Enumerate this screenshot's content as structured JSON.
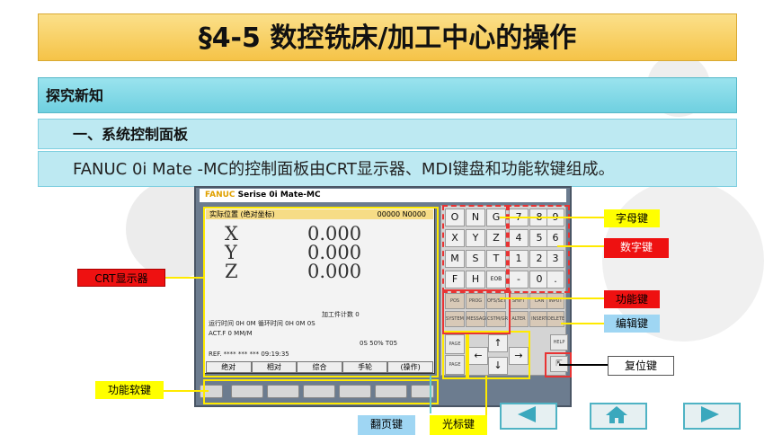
{
  "slide": {
    "title": "§4-5  数控铣床/加工中心的操作",
    "section": "探究新知",
    "subsection": "一、系统控制面板",
    "description": "FANUC 0i Mate -MC的控制面板由CRT显示器、MDI键盘和功能软键组成。"
  },
  "panel": {
    "brand": "FANUC",
    "model": "Serise 0i Mate-MC",
    "screen_header_left": "实际位置  (绝对坐标)",
    "screen_header_right": "00000  N0000",
    "axes": [
      {
        "label": "X",
        "value": "0.000"
      },
      {
        "label": "Y",
        "value": "0.000"
      },
      {
        "label": "Z",
        "value": "0.000"
      }
    ],
    "status_line1": "加工件计数                0",
    "status_line2": "运行时间         0H 0M   循环时间        0H  0M   0S",
    "status_line3": "ACT.F           0   MM/M",
    "status_line4": "0S   50%   T05",
    "status_line5": "REF.   **** *** ***      09:19:35",
    "softkeys": [
      "绝对",
      "相对",
      "综合",
      "手轮",
      "(操作)"
    ],
    "keys_letters": [
      "O",
      "N",
      "G",
      "X",
      "Y",
      "Z",
      "M",
      "S",
      "T",
      "F",
      "H",
      "EOB"
    ],
    "keys_numbers": [
      "7",
      "8",
      "9",
      "4",
      "5",
      "6",
      "1",
      "2",
      "3",
      "-",
      "0",
      "."
    ],
    "func_keys": [
      "POS",
      "PROG",
      "OFS/SET",
      "SHIFT",
      "CAN",
      "INPUT",
      "SYSTEM",
      "MESSAGE",
      "CSTM/GR",
      "ALTER",
      "INSERT",
      "DELETE"
    ],
    "page_keys": [
      "PAGE",
      "PAGE"
    ],
    "help_key": "HELP",
    "reset_key": "RESET"
  },
  "callouts": {
    "crt": "CRT显示器",
    "letter_keys": "字母键",
    "number_keys": "数字键",
    "function_keys": "功能键",
    "edit_keys": "编辑键",
    "reset_key": "复位键",
    "soft_keys": "功能软键",
    "page_keys": "翻页键",
    "cursor_keys": "光标键"
  },
  "nav": {
    "prev": "prev-icon",
    "home": "home-icon",
    "next": "next-icon"
  },
  "colors": {
    "title_bg": "#f5c347",
    "section_bg": "#6fd0e0",
    "highlight_yellow": "#ffff00",
    "label_red": "#ee1111",
    "label_blue": "#9fd6f3"
  }
}
